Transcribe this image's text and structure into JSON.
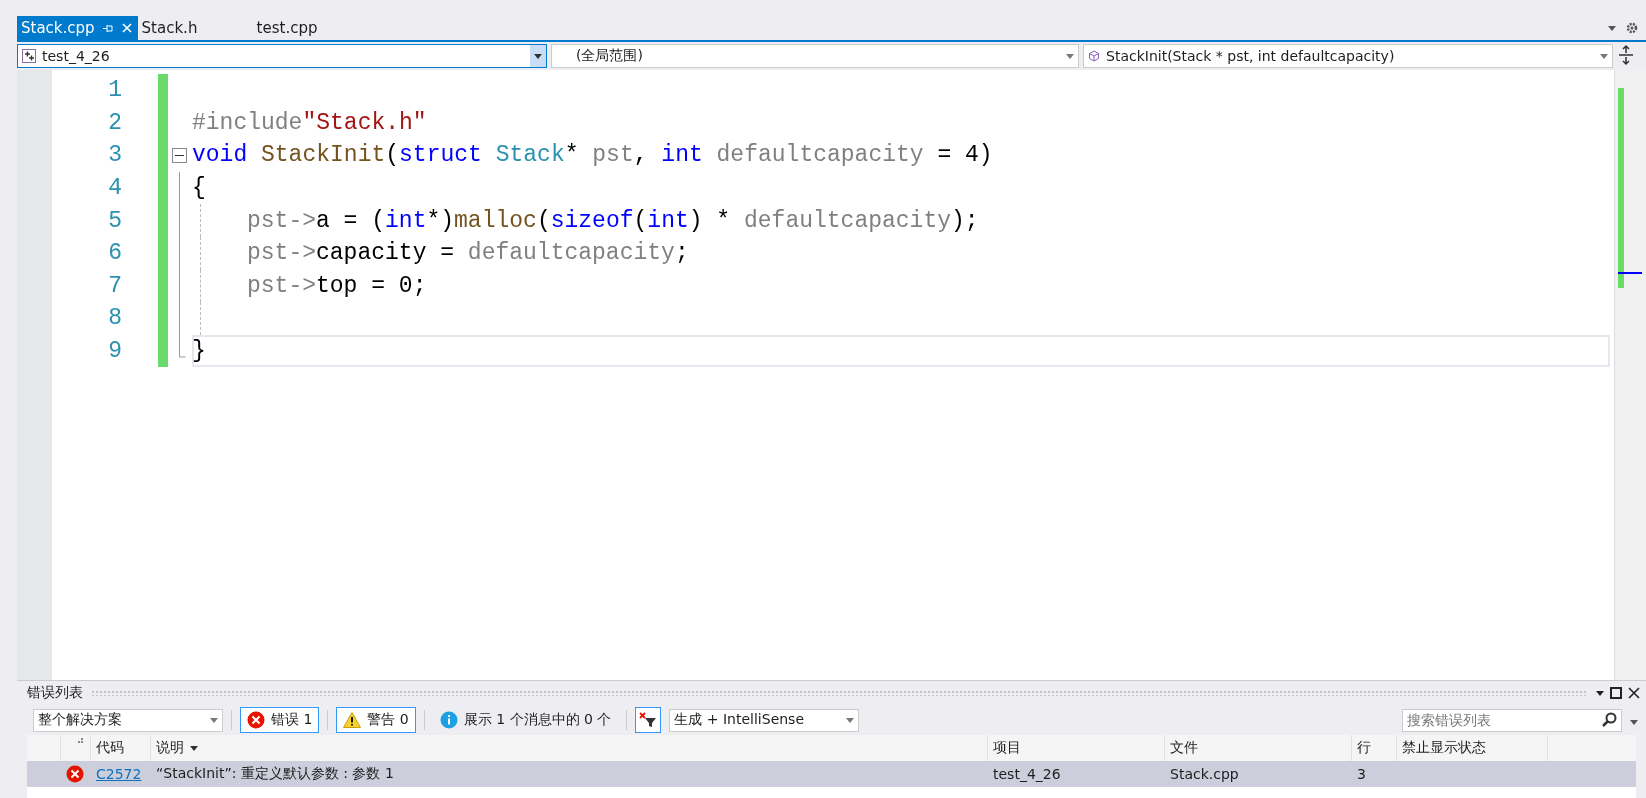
{
  "tabs": [
    {
      "label": "Stack.cpp",
      "selected": true,
      "pinned": true
    },
    {
      "label": "Stack.h",
      "selected": false,
      "pinned": false
    },
    {
      "label": "test.cpp",
      "selected": false,
      "pinned": false
    }
  ],
  "navigation": {
    "project": "test_4_26",
    "scope": "(全局范围)",
    "member": "StackInit(Stack * pst, int defaultcapacity)"
  },
  "editor": {
    "lines": [
      {
        "number": "1",
        "indented": false,
        "current": false
      },
      {
        "number": "2",
        "indented": false,
        "current": false,
        "tokens": [
          {
            "t": "#include",
            "kind": "pre"
          },
          {
            "t": "\"Stack.h\"",
            "kind": "str"
          }
        ]
      },
      {
        "number": "3",
        "indented": false,
        "current": false,
        "expanded": true,
        "tokens": [
          {
            "t": "void ",
            "kind": "kw"
          },
          {
            "t": "StackInit",
            "kind": "func"
          },
          {
            "t": "(",
            "kind": "plain"
          },
          {
            "t": "struct ",
            "kind": "kw"
          },
          {
            "t": "Stack",
            "kind": "type"
          },
          {
            "t": "* ",
            "kind": "plain"
          },
          {
            "t": "pst",
            "kind": "param"
          },
          {
            "t": ", ",
            "kind": "plain"
          },
          {
            "t": "int ",
            "kind": "kw"
          },
          {
            "t": "defaultcapacity",
            "kind": "param"
          },
          {
            "t": " = 4)",
            "kind": "plain"
          }
        ]
      },
      {
        "number": "4",
        "indented": false,
        "current": false,
        "tokens": [
          {
            "t": "{",
            "kind": "plain"
          }
        ]
      },
      {
        "number": "5",
        "indented": true,
        "current": false,
        "tokens": [
          {
            "t": "pst->",
            "kind": "param"
          },
          {
            "t": "a = (",
            "kind": "plain"
          },
          {
            "t": "int",
            "kind": "kw"
          },
          {
            "t": "*)",
            "kind": "plain"
          },
          {
            "t": "malloc",
            "kind": "func"
          },
          {
            "t": "(",
            "kind": "plain"
          },
          {
            "t": "sizeof",
            "kind": "kw"
          },
          {
            "t": "(",
            "kind": "plain"
          },
          {
            "t": "int",
            "kind": "kw"
          },
          {
            "t": ") * ",
            "kind": "plain"
          },
          {
            "t": "defaultcapacity",
            "kind": "param"
          },
          {
            "t": ");",
            "kind": "plain"
          }
        ]
      },
      {
        "number": "6",
        "indented": true,
        "current": false,
        "tokens": [
          {
            "t": "pst->",
            "kind": "param"
          },
          {
            "t": "capacity = ",
            "kind": "plain"
          },
          {
            "t": "defaultcapacity",
            "kind": "param"
          },
          {
            "t": ";",
            "kind": "plain"
          }
        ]
      },
      {
        "number": "7",
        "indented": true,
        "current": false,
        "tokens": [
          {
            "t": "pst->",
            "kind": "param"
          },
          {
            "t": "top = 0;",
            "kind": "plain"
          }
        ]
      },
      {
        "number": "8",
        "indented": true,
        "current": false
      },
      {
        "number": "9",
        "indented": false,
        "current": true,
        "tokens": [
          {
            "t": "}",
            "kind": "plain"
          }
        ]
      }
    ]
  },
  "error_list": {
    "title": "错误列表",
    "scope": "整个解决方案",
    "filters": [
      {
        "kind": "error",
        "label": "错误 1",
        "selected": true
      },
      {
        "kind": "warning",
        "label": "警告 0",
        "selected": true
      },
      {
        "kind": "info",
        "label": "展示 1 个消息中的 0 个",
        "selected": false
      }
    ],
    "source": "生成 + IntelliSense",
    "search": {
      "placeholder": "搜索错误列表"
    },
    "columns": [
      {
        "label": "代码",
        "sorted": false
      },
      {
        "label": "说明",
        "sorted": true
      },
      {
        "label": "项目",
        "sorted": false
      },
      {
        "label": "文件",
        "sorted": false
      },
      {
        "label": "行",
        "sorted": false
      },
      {
        "label": "禁止显示状态",
        "sorted": false
      }
    ],
    "rows": [
      {
        "kind": "error",
        "selected": true,
        "code": "C2572",
        "description": "“StackInit”: 重定义默认参数 : 参数 1",
        "project": "test_4_26",
        "file": "Stack.cpp",
        "line": "3"
      }
    ]
  }
}
